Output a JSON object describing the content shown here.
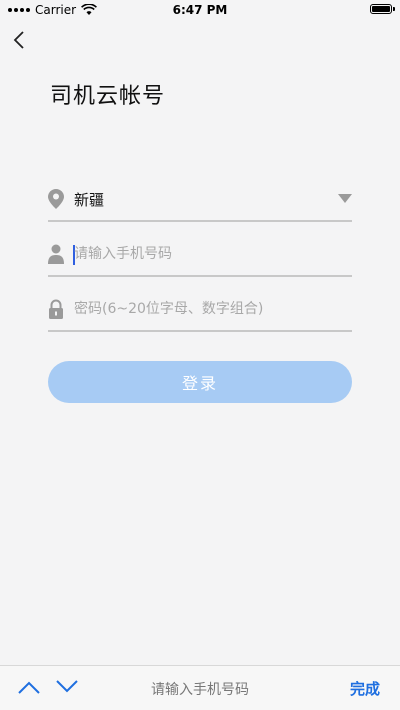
{
  "status_bar": {
    "carrier": "Carrier",
    "time": "6:47 PM"
  },
  "page": {
    "title": "司机云帐号"
  },
  "form": {
    "region_value": "新疆",
    "phone_placeholder": "请输入手机号码",
    "password_placeholder": "密码(6~20位字母、数字组合)",
    "login_label": "登录"
  },
  "keyboard_toolbar": {
    "title": "请输入手机号码",
    "done_label": "完成"
  },
  "colors": {
    "background": "#f4f4f5",
    "login_button": "#a7cbf4",
    "accent": "#1f6fe0"
  },
  "icons": [
    "back-icon",
    "location-pin-icon",
    "dropdown-arrow-icon",
    "user-icon",
    "lock-icon",
    "chevron-up-icon",
    "chevron-down-icon"
  ]
}
